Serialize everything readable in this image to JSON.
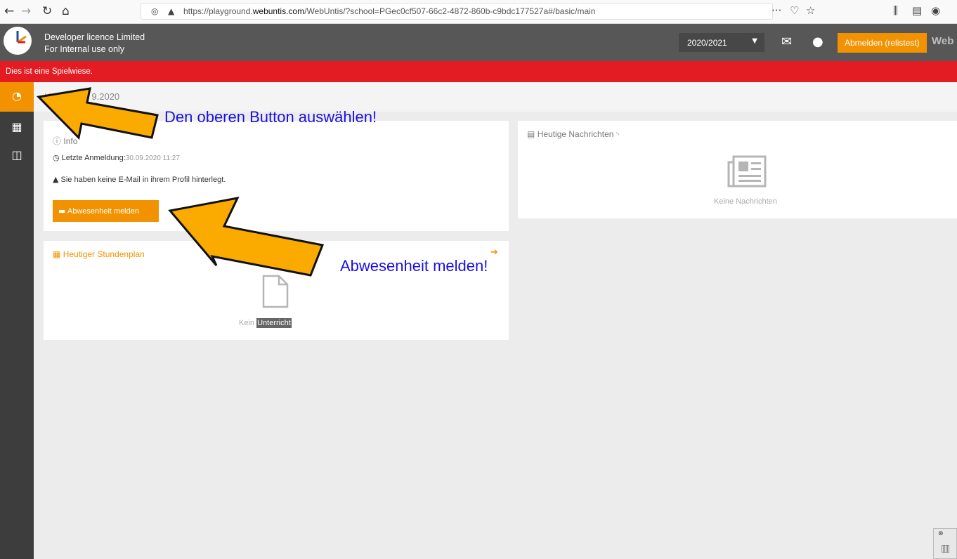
{
  "browser": {
    "url_prefix": "https://playground.",
    "url_domain": "webuntis.com",
    "url_rest": "/WebUntis/?school=PGec0cf507-66c2-4872-860b-c9bdc177527a#/basic/main",
    "more_label": "···"
  },
  "header": {
    "license_line1": "Developer licence Limited",
    "license_line2": "For Internal use only",
    "school_year": "2020/2021",
    "logout_label": "Abmelden (relistest)",
    "brand_partial": "Web"
  },
  "banner": {
    "text": "Dies ist eine Spielwiese."
  },
  "page": {
    "date_prefix": "H",
    "date_suffix": "9.2020"
  },
  "info_widget": {
    "title": "Info",
    "last_login_label": "Letzte Anmeldung:",
    "last_login_value": "30.09.2020 11:27",
    "warning": "Sie haben keine E-Mail in ihrem Profil hinterlegt.",
    "absence_button": "Abwesenheit melden"
  },
  "timetable_widget": {
    "title": "Heutiger Stundenplan",
    "empty_word1": "Kein",
    "empty_word2": "Unterricht"
  },
  "news_widget": {
    "title": "Heutige Nachrichten",
    "empty": "Keine Nachrichten"
  },
  "annotations": {
    "callout_top": "Den oberen Button auswählen!",
    "callout_bottom": "Abwesenheit melden!"
  },
  "colors": {
    "accent": "#f39200",
    "banner": "#e31c23",
    "header": "#575757",
    "sidebar": "#3d3d3d",
    "callout_text": "#1a10e6"
  }
}
